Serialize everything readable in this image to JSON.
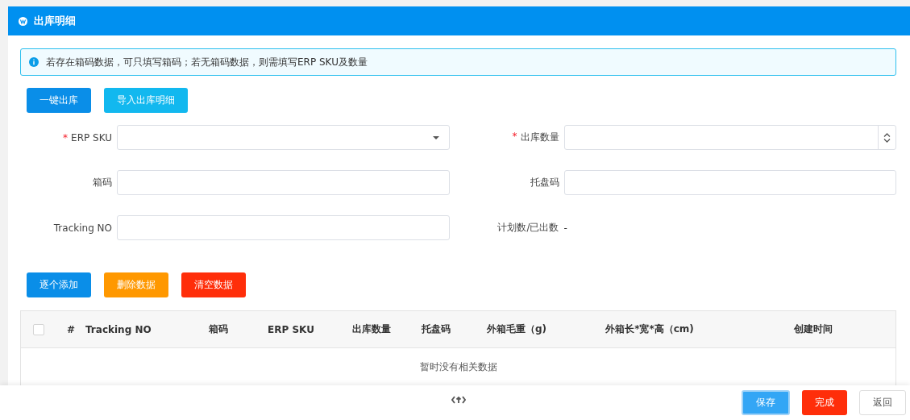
{
  "panel": {
    "title": "出库明细"
  },
  "alert": {
    "text": "若存在箱码数据，可只填写箱码；若无箱码数据，则需填写ERP SKU及数量"
  },
  "top_buttons": [
    {
      "label": "一键出库",
      "kind": "primary"
    },
    {
      "label": "导入出库明细",
      "kind": "info"
    }
  ],
  "form_fields": [
    {
      "label": "ERP SKU",
      "mark": "*",
      "kind": "select"
    },
    {
      "label": "出库数量",
      "mark": "*",
      "kind": "number"
    },
    {
      "label": "箱码",
      "kind": "text"
    },
    {
      "label": "托盘码",
      "kind": "text"
    },
    {
      "label": "Tracking NO",
      "kind": "text"
    },
    {
      "label": "计划数/已出数",
      "kind": "readonly",
      "value": "-"
    }
  ],
  "action_buttons": [
    {
      "label": "逐个添加",
      "kind": "primary"
    },
    {
      "label": "删除数据",
      "kind": "warning"
    },
    {
      "label": "清空数据",
      "kind": "danger"
    }
  ],
  "table": {
    "select_all_checked": false,
    "columns": [
      "#",
      "Tracking NO",
      "箱码",
      "ERP SKU",
      "出库数量",
      "托盘码",
      "外箱毛重（g)",
      "外箱长*宽*高（cm)",
      "创建时间"
    ],
    "empty_text": "暂时没有相关数据"
  },
  "footer_buttons": [
    {
      "label": "保存",
      "kind": "save"
    },
    {
      "label": "完成",
      "kind": "danger"
    },
    {
      "label": "返回",
      "kind": "plain"
    }
  ]
}
